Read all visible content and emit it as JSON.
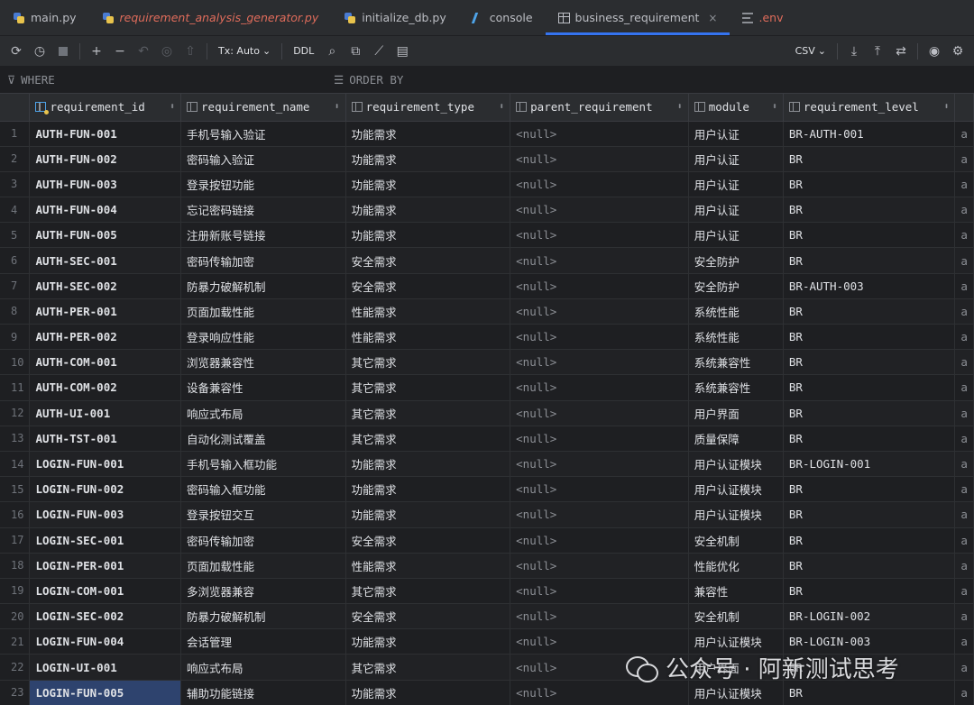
{
  "tabs": [
    {
      "label": "main.py",
      "icon": "python-file-icon",
      "style": ""
    },
    {
      "label": "requirement_analysis_generator.py",
      "icon": "python-file-icon",
      "style": "italic red"
    },
    {
      "label": "initialize_db.py",
      "icon": "python-file-icon",
      "style": ""
    },
    {
      "label": "console",
      "icon": "console-icon",
      "style": ""
    },
    {
      "label": "business_requirement",
      "icon": "table-icon",
      "style": "active"
    },
    {
      "label": ".env",
      "icon": "env-file-icon",
      "style": "red"
    }
  ],
  "toolbar": {
    "tx_label": "Tx: Auto",
    "ddl_label": "DDL",
    "export_format": "CSV"
  },
  "filter": {
    "where_label": "WHERE",
    "order_label": "ORDER BY"
  },
  "columns": [
    {
      "name": "requirement_id",
      "pk": true
    },
    {
      "name": "requirement_name",
      "pk": false
    },
    {
      "name": "requirement_type",
      "pk": false
    },
    {
      "name": "parent_requirement",
      "pk": false
    },
    {
      "name": "module",
      "pk": false
    },
    {
      "name": "requirement_level",
      "pk": false
    }
  ],
  "rows": [
    {
      "n": "1",
      "id": "AUTH-FUN-001",
      "name": "手机号输入验证",
      "type": "功能需求",
      "parent": "<null>",
      "module": "用户认证",
      "level": "BR-AUTH-001",
      "extra": "a"
    },
    {
      "n": "2",
      "id": "AUTH-FUN-002",
      "name": "密码输入验证",
      "type": "功能需求",
      "parent": "<null>",
      "module": "用户认证",
      "level": "BR",
      "extra": "a"
    },
    {
      "n": "3",
      "id": "AUTH-FUN-003",
      "name": "登录按钮功能",
      "type": "功能需求",
      "parent": "<null>",
      "module": "用户认证",
      "level": "BR",
      "extra": "a"
    },
    {
      "n": "4",
      "id": "AUTH-FUN-004",
      "name": "忘记密码链接",
      "type": "功能需求",
      "parent": "<null>",
      "module": "用户认证",
      "level": "BR",
      "extra": "a"
    },
    {
      "n": "5",
      "id": "AUTH-FUN-005",
      "name": "注册新账号链接",
      "type": "功能需求",
      "parent": "<null>",
      "module": "用户认证",
      "level": "BR",
      "extra": "a"
    },
    {
      "n": "6",
      "id": "AUTH-SEC-001",
      "name": "密码传输加密",
      "type": "安全需求",
      "parent": "<null>",
      "module": "安全防护",
      "level": "BR",
      "extra": "a"
    },
    {
      "n": "7",
      "id": "AUTH-SEC-002",
      "name": "防暴力破解机制",
      "type": "安全需求",
      "parent": "<null>",
      "module": "安全防护",
      "level": "BR-AUTH-003",
      "extra": "a"
    },
    {
      "n": "8",
      "id": "AUTH-PER-001",
      "name": "页面加载性能",
      "type": "性能需求",
      "parent": "<null>",
      "module": "系统性能",
      "level": "BR",
      "extra": "a"
    },
    {
      "n": "9",
      "id": "AUTH-PER-002",
      "name": "登录响应性能",
      "type": "性能需求",
      "parent": "<null>",
      "module": "系统性能",
      "level": "BR",
      "extra": "a"
    },
    {
      "n": "10",
      "id": "AUTH-COM-001",
      "name": "浏览器兼容性",
      "type": "其它需求",
      "parent": "<null>",
      "module": "系统兼容性",
      "level": "BR",
      "extra": "a"
    },
    {
      "n": "11",
      "id": "AUTH-COM-002",
      "name": "设备兼容性",
      "type": "其它需求",
      "parent": "<null>",
      "module": "系统兼容性",
      "level": "BR",
      "extra": "a"
    },
    {
      "n": "12",
      "id": "AUTH-UI-001",
      "name": "响应式布局",
      "type": "其它需求",
      "parent": "<null>",
      "module": "用户界面",
      "level": "BR",
      "extra": "a"
    },
    {
      "n": "13",
      "id": "AUTH-TST-001",
      "name": "自动化测试覆盖",
      "type": "其它需求",
      "parent": "<null>",
      "module": "质量保障",
      "level": "BR",
      "extra": "a"
    },
    {
      "n": "14",
      "id": "LOGIN-FUN-001",
      "name": "手机号输入框功能",
      "type": "功能需求",
      "parent": "<null>",
      "module": "用户认证模块",
      "level": "BR-LOGIN-001",
      "extra": "a"
    },
    {
      "n": "15",
      "id": "LOGIN-FUN-002",
      "name": "密码输入框功能",
      "type": "功能需求",
      "parent": "<null>",
      "module": "用户认证模块",
      "level": "BR",
      "extra": "a"
    },
    {
      "n": "16",
      "id": "LOGIN-FUN-003",
      "name": "登录按钮交互",
      "type": "功能需求",
      "parent": "<null>",
      "module": "用户认证模块",
      "level": "BR",
      "extra": "a"
    },
    {
      "n": "17",
      "id": "LOGIN-SEC-001",
      "name": "密码传输加密",
      "type": "安全需求",
      "parent": "<null>",
      "module": "安全机制",
      "level": "BR",
      "extra": "a"
    },
    {
      "n": "18",
      "id": "LOGIN-PER-001",
      "name": "页面加载性能",
      "type": "性能需求",
      "parent": "<null>",
      "module": "性能优化",
      "level": "BR",
      "extra": "a"
    },
    {
      "n": "19",
      "id": "LOGIN-COM-001",
      "name": "多浏览器兼容",
      "type": "其它需求",
      "parent": "<null>",
      "module": "兼容性",
      "level": "BR",
      "extra": "a"
    },
    {
      "n": "20",
      "id": "LOGIN-SEC-002",
      "name": "防暴力破解机制",
      "type": "安全需求",
      "parent": "<null>",
      "module": "安全机制",
      "level": "BR-LOGIN-002",
      "extra": "a"
    },
    {
      "n": "21",
      "id": "LOGIN-FUN-004",
      "name": "会话管理",
      "type": "功能需求",
      "parent": "<null>",
      "module": "用户认证模块",
      "level": "BR-LOGIN-003",
      "extra": "a"
    },
    {
      "n": "22",
      "id": "LOGIN-UI-001",
      "name": "响应式布局",
      "type": "其它需求",
      "parent": "<null>",
      "module": "用户界面",
      "level": "BR",
      "extra": "a"
    },
    {
      "n": "23",
      "id": "LOGIN-FUN-005",
      "name": "辅助功能链接",
      "type": "功能需求",
      "parent": "<null>",
      "module": "用户认证模块",
      "level": "BR",
      "extra": "a",
      "selected": true
    }
  ],
  "watermark": {
    "text": "公众号 · 阿新测试思考"
  }
}
